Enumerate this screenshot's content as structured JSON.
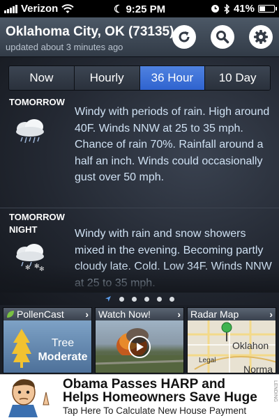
{
  "status_bar": {
    "carrier": "Verizon",
    "time": "9:25 PM",
    "battery": "41%",
    "battery_level": 0.41
  },
  "header": {
    "location": "Oklahoma City, OK (73135)",
    "updated": "updated about 3 minutes ago",
    "icons": [
      "refresh-icon",
      "search-icon",
      "gear-icon"
    ]
  },
  "tabs": [
    {
      "label": "Now",
      "active": false
    },
    {
      "label": "Hourly",
      "active": false
    },
    {
      "label": "36 Hour",
      "active": true
    },
    {
      "label": "10 Day",
      "active": false
    }
  ],
  "forecast": [
    {
      "label_line1": "TOMORROW",
      "label_line2": "",
      "icon": "rain-cloud-icon",
      "text": "Windy with periods of rain. High around 40F. Winds NNW at 25 to 35 mph. Chance of rain 70%. Rainfall around a half an inch. Winds could occasionally gust over 50 mph."
    },
    {
      "label_line1": "TOMORROW",
      "label_line2": "NIGHT",
      "icon": "rain-snow-cloud-icon",
      "text": "Windy with rain and snow showers mixed in the evening. Becoming partly cloudy late. Cold. Low 34F. Winds NNW at 25 to 35 mph."
    }
  ],
  "pager": {
    "dot_count": 5
  },
  "cards": {
    "pollen": {
      "title": "PollenCast",
      "type": "Tree",
      "level": "Moderate"
    },
    "video": {
      "title": "Watch Now!"
    },
    "radar": {
      "title": "Radar Map",
      "map_label": "Oklahon",
      "map_label2": "Norma",
      "legal": "Legal"
    }
  },
  "ad": {
    "headline1": "Obama Passes HARP and",
    "headline2": "Helps Homeowners Save Huge",
    "subtext": "Tap Here To Calculate New House Payment",
    "tag": "LENDING"
  }
}
